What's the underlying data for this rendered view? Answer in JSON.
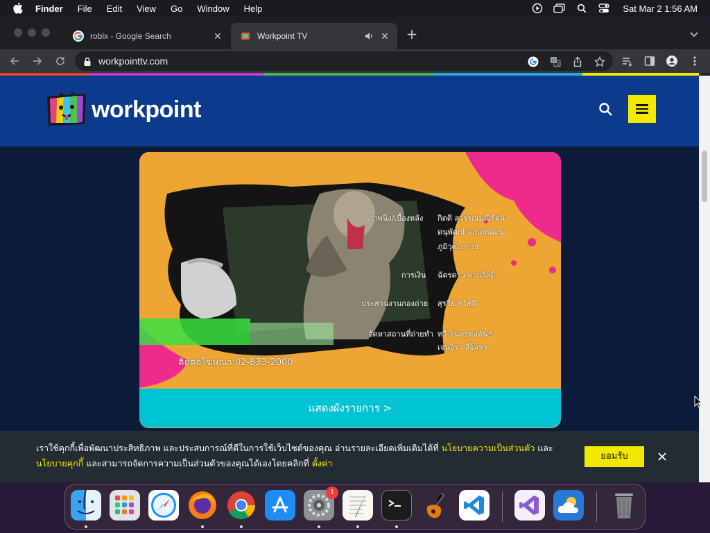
{
  "menubar": {
    "app_name": "Finder",
    "items": [
      "File",
      "Edit",
      "View",
      "Go",
      "Window",
      "Help"
    ],
    "clock": "Sat Mar 2  1:56 AM"
  },
  "browser": {
    "tabs": [
      {
        "title": "roblx - Google Search",
        "favicon": "google-icon"
      },
      {
        "title": "Workpoint TV",
        "favicon": "workpoint-favicon",
        "audio": true
      }
    ],
    "url": "workpointtv.com"
  },
  "site": {
    "logo_text": "workpoint",
    "banner": {
      "credits": [
        {
          "label": "ภาพนิ่ง/เบื้องหลัง",
          "names": [
            "กิตติ สุวรรณมณีรัตน์",
            "ดนุพัฒน์ ลอนพพัฒน",
            "ภูมิวุฒิ ภารง"
          ]
        },
        {
          "label": "การเงิน",
          "names": [
            "ฉัตรดาว คงสวัสดิ์"
          ]
        },
        {
          "label": "ประสานงานกองถ่าย",
          "names": [
            "สุรวีย์ สวัสดี"
          ]
        },
        {
          "label": "จัดหาสถานที่ถ่ายทำ",
          "names": [
            "ทวี จันทรพลพันธ์",
            "เจนจิรา สีโลพร"
          ]
        }
      ],
      "contact": "ติดต่อโฆษณา  02-833-2000"
    },
    "schedule_button": "แสดงผังรายการ >"
  },
  "cookie": {
    "text_1": "เราใช้คุกกี้เพื่อพัฒนาประสิทธิภาพ และประสบการณ์ที่ดีในการใช้เว็บไซต์ของคุณ อ่านรายละเอียดเพิ่มเติมได้ที่ ",
    "link_1": "นโยบายความเป็นส่วนตัว",
    "text_2": " และ",
    "link_2": "นโยบายคุกกี้",
    "text_3": " และสามารถจัดการความเป็นส่วนตัวของคุณได้เองโดยคลิกที่ ",
    "link_3": "ตั้งค่า",
    "accept": "ยอมรับ"
  },
  "dock": {
    "items": [
      "Finder",
      "Launchpad",
      "Safari",
      "Firefox",
      "Google Chrome",
      "App Store",
      "System Preferences",
      "TextEdit",
      "Terminal",
      "GarageBand",
      "Visual Studio Code",
      "Visual Studio",
      "Weather",
      "Trash"
    ],
    "system_preferences_badge": "1"
  },
  "colors": {
    "header_blue": "#0c3a8c",
    "page_navy": "#0d1b3a",
    "accent_yellow": "#f2e900",
    "button_cyan": "#00c3d4",
    "banner_orange": "#eda633"
  }
}
